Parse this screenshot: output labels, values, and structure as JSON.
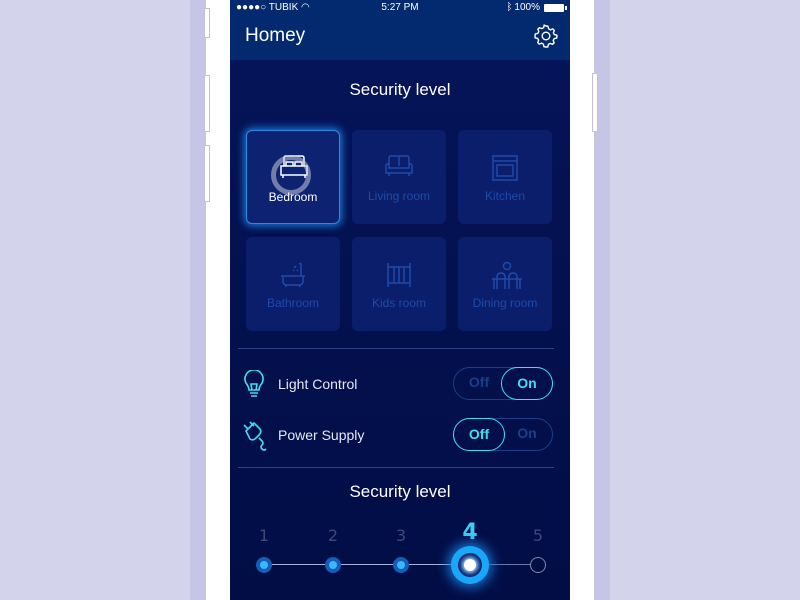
{
  "status_bar": {
    "carrier": "●●●●○ TUBIK",
    "time": "5:27 PM",
    "battery": "100%"
  },
  "header": {
    "title": "Homey"
  },
  "rooms_section": {
    "title": "Security level"
  },
  "rooms": [
    {
      "label": "Bedroom",
      "icon": "bed-icon",
      "selected": true
    },
    {
      "label": "Living room",
      "icon": "sofa-icon",
      "selected": false
    },
    {
      "label": "Kitchen",
      "icon": "oven-icon",
      "selected": false
    },
    {
      "label": "Bathroom",
      "icon": "bathtub-icon",
      "selected": false
    },
    {
      "label": "Kids room",
      "icon": "crib-icon",
      "selected": false
    },
    {
      "label": "Dining room",
      "icon": "dining-icon",
      "selected": false
    }
  ],
  "controls": [
    {
      "label": "Light Control",
      "icon": "lightbulb-icon",
      "off_label": "Off",
      "on_label": "On",
      "state": "On"
    },
    {
      "label": "Power Supply",
      "icon": "plug-icon",
      "off_label": "Off",
      "on_label": "On",
      "state": "Off"
    }
  ],
  "security_level": {
    "title": "Security level",
    "levels": [
      "1",
      "2",
      "3",
      "4",
      "5"
    ],
    "current": 4
  },
  "colors": {
    "accent": "#3ee0f0",
    "navbar": "#032a6e",
    "screen_bg": "#03104d",
    "highlight": "#19a8f8"
  }
}
